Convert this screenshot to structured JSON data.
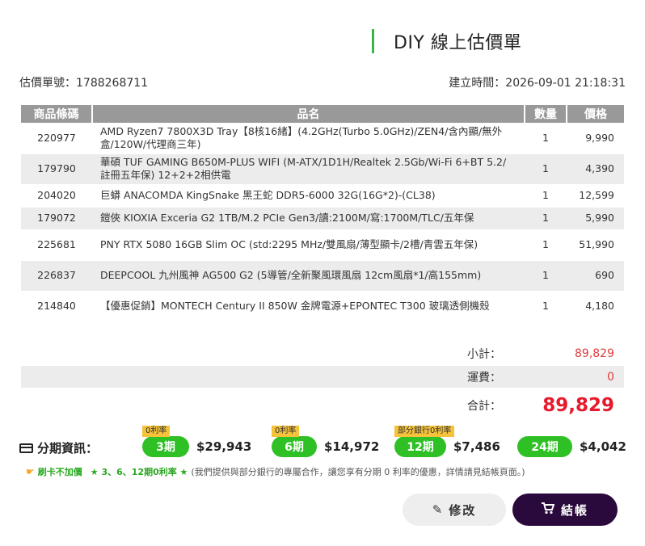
{
  "page_title": "DIY 線上估價單",
  "quote": {
    "number_label": "估價單號：",
    "number": "1788268711",
    "created_label": "建立時間：",
    "created": "2026-09-01 21:18:31"
  },
  "table": {
    "headers": {
      "code": "商品條碼",
      "name": "品名",
      "qty": "數量",
      "price": "價格"
    },
    "rows": [
      {
        "code": "220977",
        "name": "AMD Ryzen7 7800X3D Tray【8核16緒】(4.2GHz(Turbo 5.0GHz)/ZEN4/含內顯/無外盒/120W/代理商三年)",
        "qty": "1",
        "price": "9,990"
      },
      {
        "code": "179790",
        "name": "華碩 TUF GAMING B650M-PLUS WIFI (M-ATX/1D1H/Realtek 2.5Gb/Wi-Fi 6+BT 5.2/註冊五年保) 12+2+2相供電",
        "qty": "1",
        "price": "4,390"
      },
      {
        "code": "204020",
        "name": "巨蟒 ANACOMDA KingSnake 黑王蛇 DDR5-6000 32G(16G*2)-(CL38)",
        "qty": "1",
        "price": "12,599"
      },
      {
        "code": "179072",
        "name": "鎧俠 KIOXIA Exceria G2 1TB/M.2 PCIe Gen3/讀:2100M/寫:1700M/TLC/五年保",
        "qty": "1",
        "price": "5,990"
      },
      {
        "code": "225681",
        "name": "PNY RTX 5080 16GB Slim OC (std:2295 MHz/雙風扇/薄型顯卡/2槽/青雲五年保)",
        "qty": "1",
        "price": "51,990"
      },
      {
        "code": "226837",
        "name": "DEEPCOOL 九州風神 AG500 G2 (5導管/全新聚風環風扇 12cm風扇*1/高155mm)",
        "qty": "1",
        "price": "690"
      },
      {
        "code": "214840",
        "name": "【優惠促銷】MONTECH Century II 850W 金牌電源+EPONTEC T300 玻璃透側機殼",
        "qty": "1",
        "price": "4,180"
      }
    ]
  },
  "summary": {
    "subtotal_label": "小計：",
    "subtotal": "89,829",
    "shipping_label": "運費：",
    "shipping": "0",
    "total_label": "合計：",
    "total": "89,829"
  },
  "installments": {
    "label": "分期資訊：",
    "plans": [
      {
        "tag": "0利率",
        "term": "3期",
        "amount": "$29,943"
      },
      {
        "tag": "0利率",
        "term": "6期",
        "amount": "$14,972"
      },
      {
        "tag": "部分銀行0利率",
        "term": "12期",
        "amount": "$7,486"
      },
      {
        "tag": "",
        "term": "24期",
        "amount": "$4,042"
      }
    ],
    "note_highlight": "刷卡不加價",
    "note_highlight2": "★ 3、6、12期0利率 ★",
    "note_text": "(我們提供與部分銀行的專屬合作，讓您享有分期 0 利率的優惠，詳情請見結帳頁面。)"
  },
  "buttons": {
    "edit": "修改",
    "checkout": "結帳"
  },
  "colors": {
    "accent_green": "#2ec025",
    "price_red": "#e8192c",
    "checkout_bg": "#2a0a3c",
    "tag_yellow": "#f5c23a"
  },
  "icons": {
    "card": "credit-card-icon",
    "hand": "pointing-hand-icon",
    "pencil": "pencil-icon",
    "cart": "cart-icon"
  }
}
